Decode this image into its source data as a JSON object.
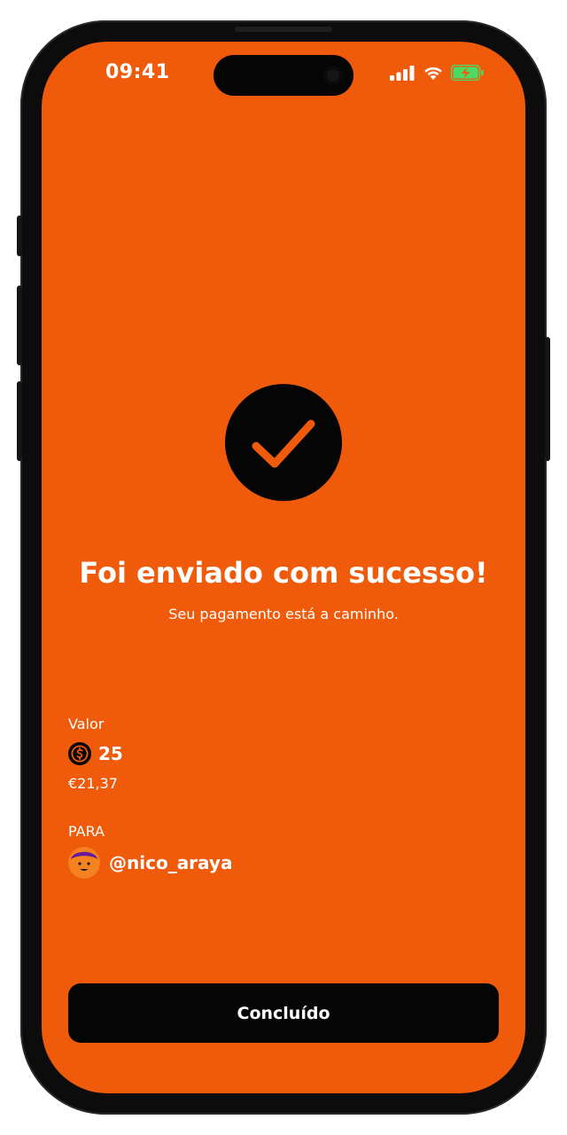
{
  "status_bar": {
    "time": "09:41"
  },
  "success": {
    "title": "Foi enviado com sucesso!",
    "subtitle": "Seu pagamento está a caminho."
  },
  "payment": {
    "amount_label": "Valor",
    "amount": "25",
    "fiat_value": "€21,37",
    "recipient_label": "PARA",
    "recipient_handle": "@nico_araya"
  },
  "actions": {
    "done_label": "Concluído"
  },
  "icons": {
    "success": "checkmark-icon",
    "currency": "dollar-coin-icon",
    "signal": "cellular-signal-icon",
    "wifi": "wifi-icon",
    "battery": "battery-charging-icon"
  },
  "colors": {
    "background": "#ef5b0a",
    "button": "#050505",
    "text": "#ffffff",
    "battery": "#4cd964"
  }
}
